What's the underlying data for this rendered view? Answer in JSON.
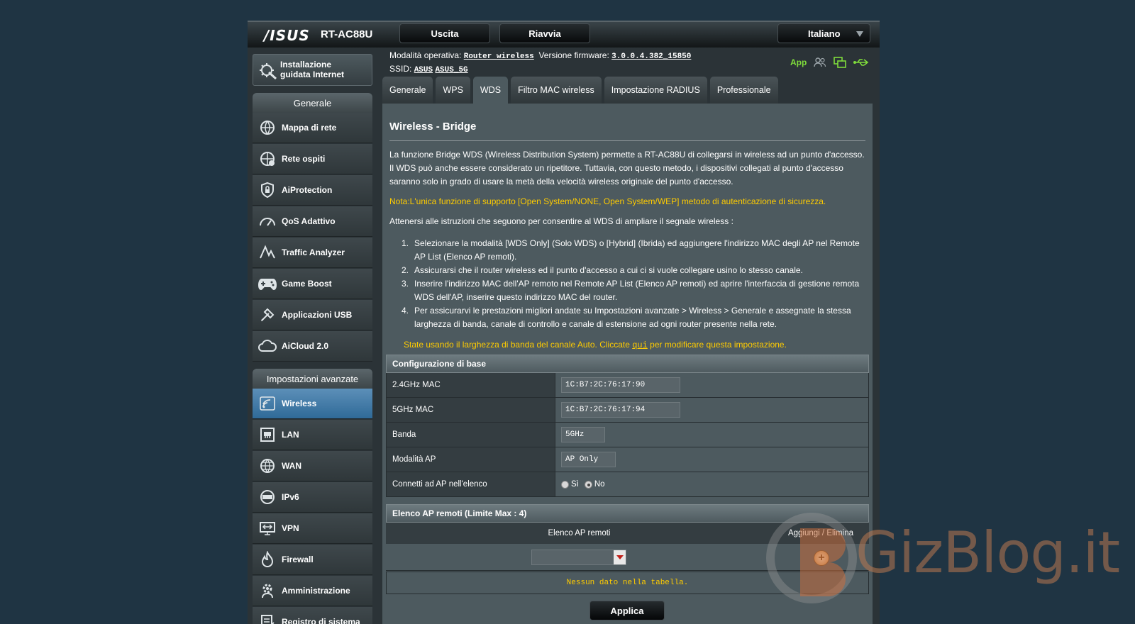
{
  "header": {
    "brand": "/ISUS",
    "model": "RT-AC88U",
    "logout_label": "Uscita",
    "reboot_label": "Riavvia",
    "language": "Italiano"
  },
  "info": {
    "mode_label": "Modalità operativa:",
    "mode_value": "Router wireless",
    "firmware_label": "Versione firmware:",
    "firmware_value": "3.0.0.4.382_15850",
    "ssid_label": "SSID:",
    "ssid_1": "ASUS",
    "ssid_2": "ASUS_5G",
    "app_label": "App",
    "accent_color": "#7fdc3b"
  },
  "sidebar": {
    "qis_label_1": "Installazione",
    "qis_label_2": "guidata Internet",
    "general_header": "Generale",
    "general_items": [
      {
        "label": "Mappa di rete",
        "icon": "network-map-icon"
      },
      {
        "label": "Rete ospiti",
        "icon": "guest-network-icon"
      },
      {
        "label": "AiProtection",
        "icon": "shield-lock-icon"
      },
      {
        "label": "QoS Adattivo",
        "icon": "speedometer-icon"
      },
      {
        "label": "Traffic Analyzer",
        "icon": "traffic-chart-icon"
      },
      {
        "label": "Game Boost",
        "icon": "gamepad-icon"
      },
      {
        "label": "Applicazioni USB",
        "icon": "usb-app-icon"
      },
      {
        "label": "AiCloud 2.0",
        "icon": "cloud-icon"
      }
    ],
    "advanced_header": "Impostazioni avanzate",
    "advanced_items": [
      {
        "label": "Wireless",
        "icon": "wireless-icon",
        "active": true
      },
      {
        "label": "LAN",
        "icon": "lan-icon"
      },
      {
        "label": "WAN",
        "icon": "globe-icon"
      },
      {
        "label": "IPv6",
        "icon": "ipv6-icon"
      },
      {
        "label": "VPN",
        "icon": "vpn-icon"
      },
      {
        "label": "Firewall",
        "icon": "firewall-icon"
      },
      {
        "label": "Amministrazione",
        "icon": "admin-gear-icon"
      },
      {
        "label": "Registro di sistema",
        "icon": "system-log-icon"
      }
    ],
    "active_color": "#2f6a98"
  },
  "tabs": [
    "Generale",
    "WPS",
    "WDS",
    "Filtro MAC wireless",
    "Impostazione RADIUS",
    "Professionale"
  ],
  "active_tab": "WDS",
  "main": {
    "title": "Wireless - Bridge",
    "description": "La funzione Bridge WDS (Wireless Distribution System) permette a RT-AC88U di collegarsi in wireless ad un punto d'accesso. Il WDS può anche essere considerato un ripetitore. Tuttavia, con questo metodo, i dispositivi collegati al punto d'accesso saranno solo in grado di usare la metà della velocità wireless originale del punto d'accesso.",
    "note": "Nota:L'unica funzione di supporto [Open System/NONE, Open System/WEP] metodo di autenticazione di sicurezza.",
    "intro": "Attenersi alle istruzioni che seguono per consentire al WDS di ampliare il segnale wireless :",
    "steps": [
      "Selezionare la modalità [WDS Only] (Solo WDS) o [Hybrid] (Ibrida) ed aggiungere l'indirizzo MAC degli AP nel Remote AP List (Elenco AP remoti).",
      "Assicurarsi che il router wireless ed il punto d'accesso a cui ci si vuole collegare usino lo stesso canale.",
      "Inserire l'indirizzo MAC dell'AP remoto nel Remote AP List (Elenco AP remoti) ed aprire l'interfaccia di gestione remota WDS dell'AP, inserire questo indirizzo MAC del router.",
      "Per assicurarvi le prestazioni migliori andate su Impostazioni avanzate > Wireless > Generale e assegnate la stessa larghezza di banda, canale di controllo e canale di estensione ad ogni router presente nella rete."
    ],
    "bw_note_pre": "State usando il larghezza di banda del canale Auto. Cliccate ",
    "bw_note_link": "qui",
    "bw_note_post": " per modificare questa impostazione.",
    "note_color": "#ffcc00"
  },
  "basic_config": {
    "header": "Configurazione di base",
    "mac24_label": "2.4GHz MAC",
    "mac24_value": "1C:B7:2C:76:17:90",
    "mac5_label": "5GHz MAC",
    "mac5_value": "1C:B7:2C:76:17:94",
    "band_label": "Banda",
    "band_value": "5GHz",
    "apmode_label": "Modalità AP",
    "apmode_value": "AP Only",
    "connect_label": "Connetti ad AP nell'elenco",
    "radio_yes": "Sì",
    "radio_no": "No",
    "radio_selected": "No"
  },
  "remote_ap": {
    "header": "Elenco AP remoti (Limite Max : 4)",
    "col_list": "Elenco AP remoti",
    "col_action": "Aggiungi / Elimina",
    "empty": "Nessun dato nella tabella."
  },
  "apply_label": "Applica",
  "watermark": "GizBlog.it"
}
